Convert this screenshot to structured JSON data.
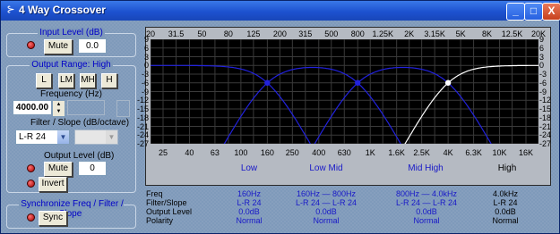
{
  "window": {
    "title": "4 Way Crossover",
    "icon": "crossover-app-icon",
    "min": "_",
    "max": "□",
    "close": "X"
  },
  "input": {
    "group": "Input Level (dB)",
    "mute": "Mute",
    "value": "0.0"
  },
  "output_range": {
    "group": "Output Range: High",
    "buttons": [
      "L",
      "LM",
      "MH",
      "H"
    ],
    "freq_label": "Frequency (Hz)",
    "freq_value": "4000.00",
    "filter_label": "Filter / Slope (dB/octave)",
    "filter_value": "L-R 24",
    "level_label": "Output Level (dB)",
    "level_mute": "Mute",
    "level_value": "0",
    "invert": "Invert"
  },
  "sync": {
    "group": "Synchronize Freq / Filter / Slope",
    "button": "Sync"
  },
  "graph": {
    "top_ticks": [
      "20",
      "31.5",
      "50",
      "80",
      "125",
      "200",
      "315",
      "500",
      "800",
      "1.25K",
      "2K",
      "3.15K",
      "5K",
      "8K",
      "12.5K",
      "20K"
    ],
    "bottom_ticks": [
      "25",
      "40",
      "63",
      "100",
      "160",
      "250",
      "400",
      "630",
      "1K",
      "1.6K",
      "2.5K",
      "4K",
      "6.3K",
      "10K",
      "16K"
    ],
    "y_ticks": [
      "9",
      "6",
      "3",
      "0",
      "-3",
      "-6",
      "-9",
      "-12",
      "-15",
      "-18",
      "-21",
      "-24",
      "-27"
    ]
  },
  "bands": {
    "low": "Low",
    "low_mid": "Low Mid",
    "mid_high": "Mid High",
    "high": "High"
  },
  "table": {
    "row_labels": [
      "Freq",
      "Filter/Slope",
      "Output Level",
      "Polarity"
    ],
    "low": [
      "160Hz",
      "L-R 24",
      "0.0dB",
      "Normal"
    ],
    "low_mid": [
      "160Hz — 800Hz",
      "L-R 24 — L-R 24",
      "0.0dB",
      "Normal"
    ],
    "mid_high": [
      "800Hz — 4.0kHz",
      "L-R 24 — L-R 24",
      "0.0dB",
      "Normal"
    ],
    "high": [
      "4.0kHz",
      "L-R 24",
      "0.0dB",
      "Normal"
    ]
  },
  "chart_data": {
    "type": "line",
    "x_scale": "log",
    "xlim_hz": [
      20,
      20000
    ],
    "ylim_db": [
      -27,
      9
    ],
    "grid": true,
    "series": [
      {
        "color": "#2222dd",
        "crossover_hz": [
          160
        ]
      },
      {
        "color": "#2222dd",
        "crossover_hz": [
          160,
          800
        ]
      },
      {
        "color": "#2222dd",
        "crossover_hz": [
          800,
          4000
        ]
      },
      {
        "color": "#ffffff",
        "crossover_hz": [
          4000
        ]
      }
    ],
    "markers_hz": [
      160,
      800,
      4000
    ],
    "marker_db": -6
  }
}
